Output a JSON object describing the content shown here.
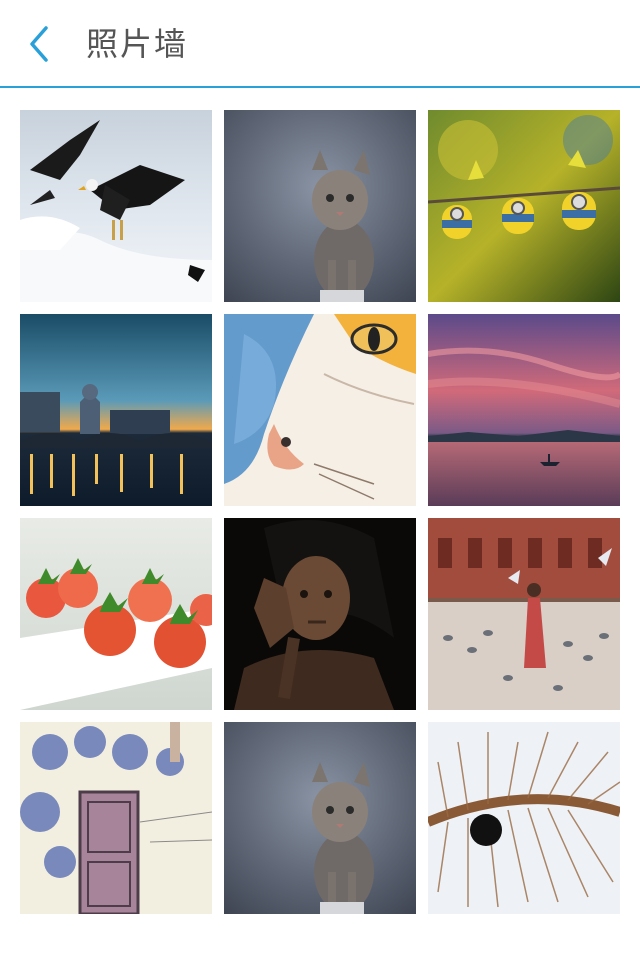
{
  "header": {
    "title": "照片墙",
    "back_icon": "chevron-left-icon",
    "accent_color": "#2aa0d8"
  },
  "photos": [
    {
      "name": "eagles-in-snow"
    },
    {
      "name": "kitten"
    },
    {
      "name": "minion-toys"
    },
    {
      "name": "city-river-night"
    },
    {
      "name": "watercolor-cat"
    },
    {
      "name": "sunset-lake-boat"
    },
    {
      "name": "strawberries"
    },
    {
      "name": "elderly-woman-portrait"
    },
    {
      "name": "square-with-pigeons"
    },
    {
      "name": "painted-doorway"
    },
    {
      "name": "kitten"
    },
    {
      "name": "leaf-veins"
    }
  ]
}
